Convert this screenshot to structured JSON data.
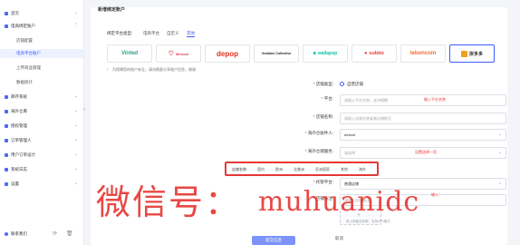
{
  "sidebar": {
    "items": [
      {
        "label": "首页",
        "expand": "⌄"
      },
      {
        "label": "电商绑定账户",
        "expand": "⌃"
      },
      {
        "label": "店铺配置",
        "sub": true
      },
      {
        "label": "电商平台账户",
        "sub": true,
        "active": true
      },
      {
        "label": "上传商品管理",
        "sub": true
      },
      {
        "label": "数据统计",
        "sub": true
      },
      {
        "label": "库存系统",
        "expand": "⌄"
      },
      {
        "label": "海外仓库",
        "expand": "⌄"
      },
      {
        "label": "授权管理",
        "expand": "⌄"
      },
      {
        "label": "订单管理人",
        "expand": "⌄"
      },
      {
        "label": "用户订单设计",
        "expand": "⌄"
      },
      {
        "label": "系统日志",
        "expand": "⌄"
      },
      {
        "label": "设置",
        "expand": "⌄"
      }
    ],
    "bottom_label": "联系我们"
  },
  "page": {
    "title": "新增绑定账户",
    "tabs_label": "绑定平台类型:",
    "tabs": [
      "电商平台",
      "自定义",
      "其他"
    ],
    "platforms": [
      "Vinted",
      "Mercari",
      "depop",
      "Vestiaire Collective",
      "wallapop",
      "subito",
      "leboncoin",
      "拼多多"
    ],
    "warning": "!",
    "warning_text": "为保障您的账户安全，请勿随意分享账户信息，谢谢",
    "form": {
      "type_label": "店铺类型:",
      "type_value": "自营店铺",
      "platform_label": "平台:",
      "platform_placeholder": "请输入平台名称，支持模糊",
      "platform_hint": "输入平台名称",
      "store_label": "店铺名称:",
      "store_placeholder": "请输入店铺名称或者店铺账号",
      "target_label": "海外仓收件人:",
      "target_value": "default",
      "warehouse_label": "海外仓储服务:",
      "warehouse_placeholder": "请选择",
      "warehouse_hint": "设置选择一项",
      "shipping_label": "店铺名称:",
      "shipping_options": [
        "国内",
        "欧洲",
        "北美洲",
        "亚洲国家",
        "其他",
        "海外"
      ],
      "platform_type_label": "托管平台:",
      "platform_type_value": "普通店铺",
      "owner_label": "店铺备注:",
      "owner_placeholder": "请输入店铺备注",
      "owner_hint": "输入：",
      "upload_hint": "请上传营业执照，支持JPG格式"
    },
    "submit": "提交信息",
    "cancel": "取消"
  },
  "watermark": {
    "cn": "微信号：",
    "en": "muhuanidc"
  }
}
